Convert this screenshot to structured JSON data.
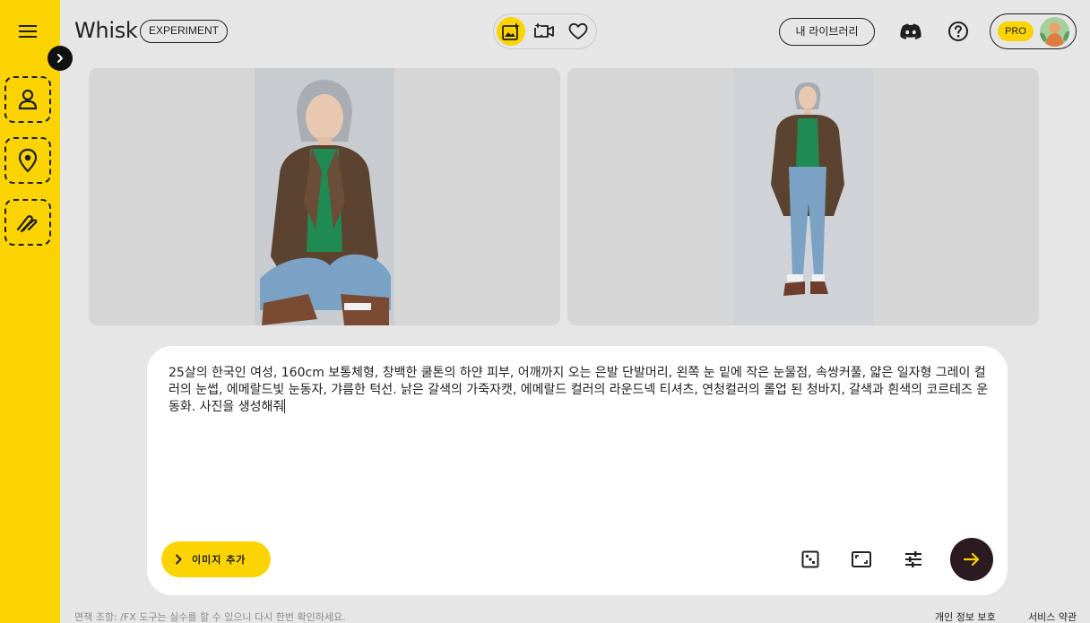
{
  "sidebar": {
    "menu_icon": "menu-icon",
    "expand_icon": "chevron-right-icon",
    "slots": [
      {
        "name": "subject-slot",
        "icon": "person-icon"
      },
      {
        "name": "scene-slot",
        "icon": "location-pin-icon"
      },
      {
        "name": "style-slot",
        "icon": "brush-icon"
      }
    ]
  },
  "header": {
    "brand": "Whisk",
    "badge": "EXPERIMENT",
    "modes": [
      {
        "icon": "image-sparkle-icon",
        "active": true
      },
      {
        "icon": "video-sparkle-icon",
        "active": false
      },
      {
        "icon": "heart-icon",
        "active": false
      }
    ],
    "library_label": "내 라이브러리",
    "discord_icon": "discord-icon",
    "help_icon": "help-circle-icon",
    "pro_label": "PRO",
    "avatar_icon": "avatar-image"
  },
  "results": [
    {
      "alt": "seated-portrait-image"
    },
    {
      "alt": "standing-portrait-image"
    }
  ],
  "prompt": {
    "text": "25살의 한국인 여성, 160cm 보통체형, 창백한 쿨톤의 하얀 피부, 어깨까지 오는 은발 단발머리, 왼쪽 눈 밑에 작은 눈물점, 속쌍커풀, 얇은 일자형 그레이 컬러의 눈썹, 에메랄드빛 눈동자, 갸름한 턱선. 낡은 갈색의 가죽자캣, 에메랄드 컬러의 라운드넥 티셔츠, 연청컬러의 롤업 된 청바지, 갈색과 흰색의 코르테즈 운동화. 사진을 생성해줘",
    "add_image_label": "이미지 추가",
    "tools": [
      "dice-icon",
      "aspect-ratio-icon",
      "settings-sliders-icon"
    ],
    "send_icon": "arrow-right-icon"
  },
  "footer": {
    "disclaimer": "면책 조항: /FX 도구는 실수를 할 수 있으니 다시 한번 확인하세요.",
    "privacy": "개인 정보 보호",
    "terms": "서비스 약관"
  },
  "colors": {
    "accent": "#fbd400",
    "background": "#e6e6e6",
    "send_button": "#2b1a1f"
  }
}
